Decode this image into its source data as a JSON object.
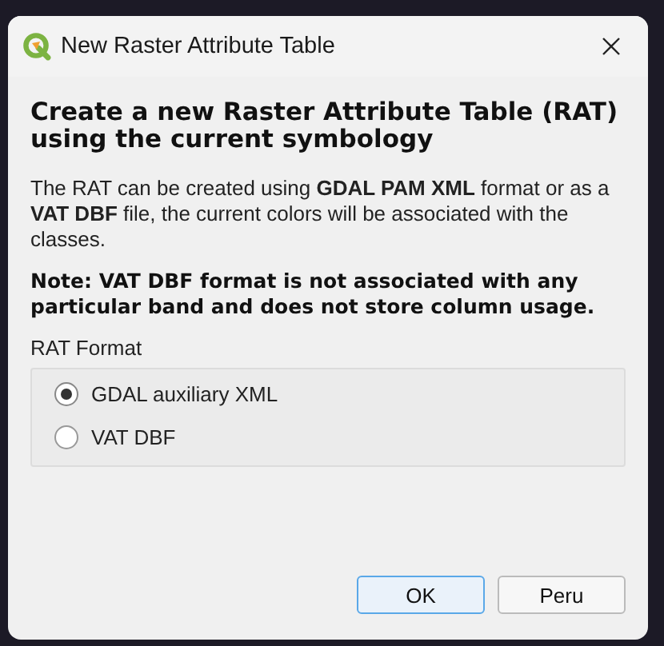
{
  "window": {
    "title": "New Raster Attribute Table"
  },
  "heading": "Create a new Raster Attribute Table (RAT) using the current symbology",
  "description": "The RAT can be created using **GDAL PAM XML** format or as a **VAT DBF** file, the current colors will be associated with the classes.",
  "note": "Note: VAT DBF format is not associated with any particular band and does not store column usage.",
  "format_group": {
    "label": "RAT Format",
    "options": [
      {
        "label": "GDAL auxiliary XML",
        "selected": true
      },
      {
        "label": "VAT DBF",
        "selected": false
      }
    ]
  },
  "buttons": [
    {
      "label": "OK",
      "kind": "default"
    },
    {
      "label": "Peru",
      "kind": "normal"
    }
  ]
}
